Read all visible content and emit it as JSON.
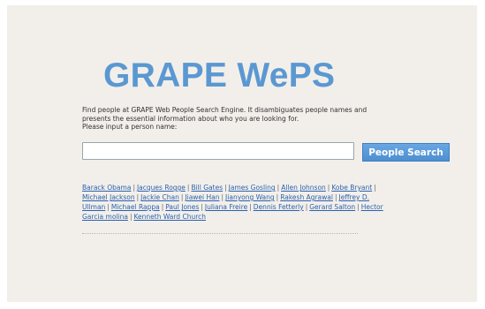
{
  "logo": {
    "title": "GRAPE WePS"
  },
  "intro": {
    "line1": "Find people at GRAPE Web People Search Engine. It disambiguates people names and",
    "line2": "presents the essential information about who you are looking for.",
    "line3": "Please input a person name:"
  },
  "search": {
    "value": "",
    "placeholder": "",
    "button_label": "People Search"
  },
  "suggestions": {
    "separator": "|",
    "names": [
      "Barack Obama",
      "Jacques Rogge",
      "Bill Gates",
      "James Gosling",
      "Allen Johnson",
      "Kobe Bryant",
      "Michael Jackson",
      "Jackie Chan",
      "Jiawei Han",
      "Jianyong Wang",
      "Rakesh Agrawal",
      "Jeffrey D. Ullman",
      "Michael Rappa",
      "Paul Jones",
      "Juliana Freire",
      "Dennis Fetterly",
      "Gerard Salton",
      "Hector Garcia molina",
      "Kenneth Ward Church"
    ],
    "line_breaks": {
      "jeffrey_part1": "Jeffrey D.",
      "jeffrey_part2": "Ullman",
      "hector_part1": "Hector",
      "hector_part2": "Garcia molina"
    }
  },
  "colors": {
    "background": "#f2efea",
    "logo": "#5b98d2",
    "link": "#2b62b0",
    "button": "#5b98d8"
  }
}
